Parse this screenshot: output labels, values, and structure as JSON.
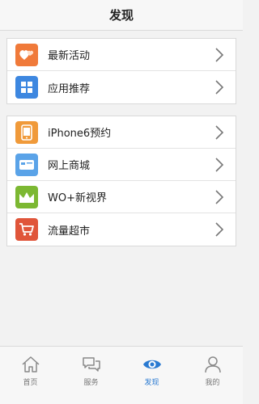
{
  "header": {
    "title": "发现"
  },
  "groups": [
    {
      "items": [
        {
          "label": "最新活动",
          "icon": "hearts-icon",
          "color": "#f07a3a"
        },
        {
          "label": "应用推荐",
          "icon": "grid-apps-icon",
          "color": "#3d87e0"
        }
      ]
    },
    {
      "items": [
        {
          "label": "iPhone6预约",
          "icon": "phone-icon",
          "color": "#f09a3a"
        },
        {
          "label": "网上商城",
          "icon": "card-icon",
          "color": "#5aa3e8"
        },
        {
          "label": "WO+新视界",
          "icon": "crown-icon",
          "color": "#7cb832"
        },
        {
          "label": "流量超市",
          "icon": "cart-icon",
          "color": "#e0553a"
        }
      ]
    }
  ],
  "tabbar": {
    "active_color": "#2a7ad1",
    "tabs": [
      {
        "label": "首页",
        "icon": "home-icon"
      },
      {
        "label": "服务",
        "icon": "chat-bubbles-icon"
      },
      {
        "label": "发现",
        "icon": "eye-icon",
        "active": true
      },
      {
        "label": "我的",
        "icon": "person-icon"
      }
    ]
  }
}
